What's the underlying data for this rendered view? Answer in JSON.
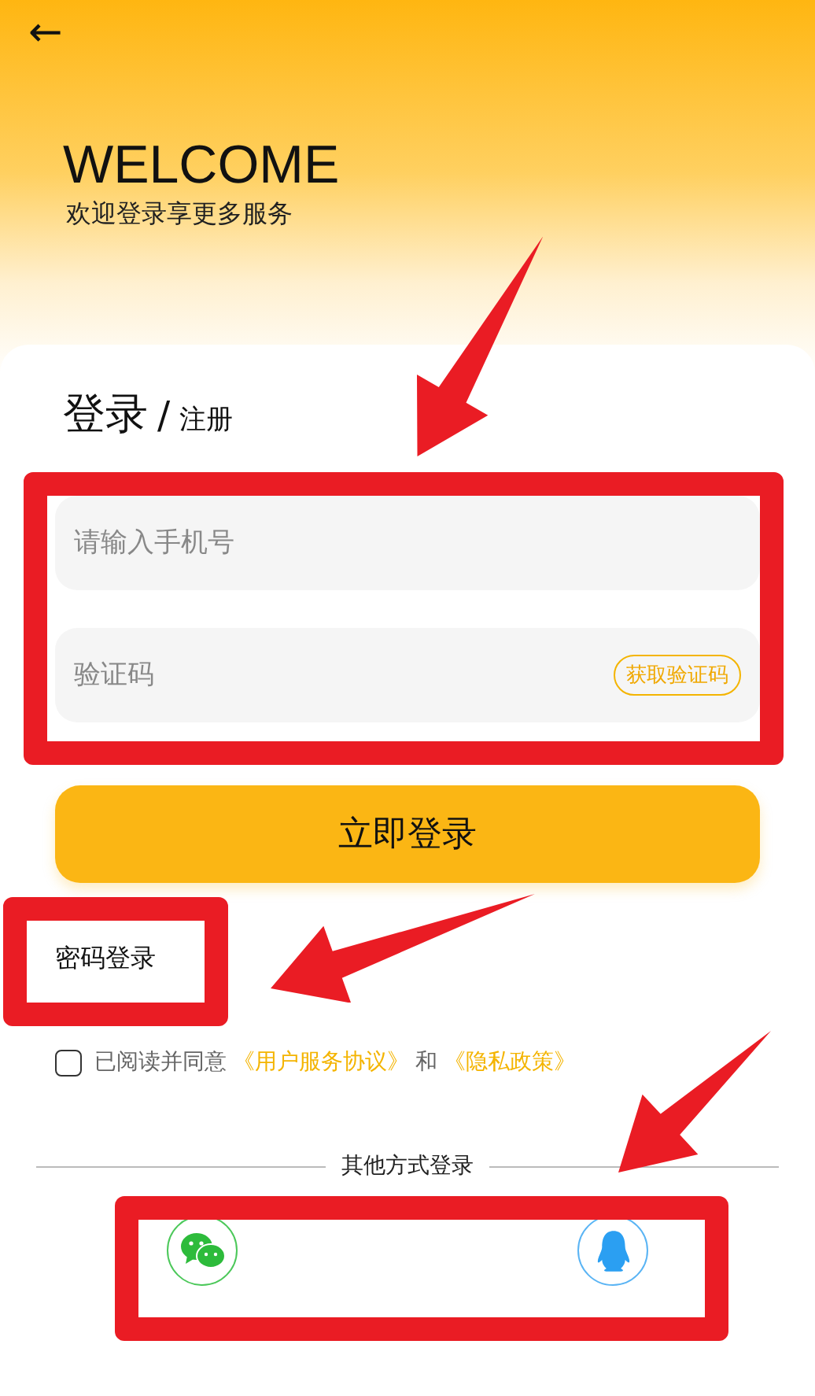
{
  "header": {
    "back": "←",
    "title": "WELCOME",
    "subtitle": "欢迎登录享更多服务"
  },
  "heading": {
    "primary": "登录",
    "separator": "/",
    "secondary": "注册"
  },
  "fields": [
    {
      "kind": "text",
      "placeholder": "请输入手机号"
    },
    {
      "kind": "code",
      "placeholder": "验证码",
      "action": "获取验证码"
    }
  ],
  "submit": "立即登录",
  "alt_link": "密码登录",
  "agreement": {
    "checked": false,
    "text": "已阅读并同意",
    "link1": "《用户服务协议》",
    "joiner": "和",
    "link2": "《隐私政策》"
  },
  "other": {
    "label": "其他方式登录",
    "methods": [
      {
        "kind": "wechat"
      },
      {
        "kind": "qq"
      }
    ]
  },
  "annotations": [
    {
      "kind": "arrow"
    },
    {
      "kind": "frame"
    },
    {
      "kind": "arrow"
    },
    {
      "kind": "frame"
    },
    {
      "kind": "arrow"
    },
    {
      "kind": "frame"
    }
  ]
}
